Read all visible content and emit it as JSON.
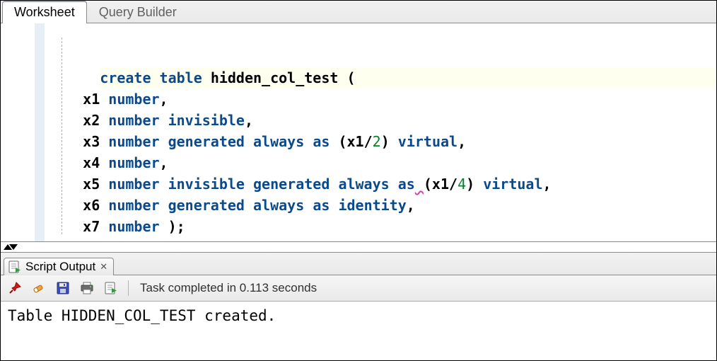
{
  "tabs": {
    "worksheet": "Worksheet",
    "query_builder": "Query Builder"
  },
  "code": {
    "lines": [
      {
        "indent": 0,
        "tokens": [
          {
            "t": "create",
            "c": "kw"
          },
          {
            "t": " ",
            "c": "plain"
          },
          {
            "t": "table",
            "c": "kw"
          },
          {
            "t": " ",
            "c": "plain"
          },
          {
            "t": "hidden_col_test",
            "c": "ident"
          },
          {
            "t": " ",
            "c": "plain"
          },
          {
            "t": "(",
            "c": "paren"
          }
        ],
        "hl": true
      },
      {
        "indent": 1,
        "tokens": [
          {
            "t": "x1 ",
            "c": "plain"
          },
          {
            "t": "number",
            "c": "kw"
          },
          {
            "t": ",",
            "c": "plain"
          }
        ]
      },
      {
        "indent": 1,
        "tokens": [
          {
            "t": "x2 ",
            "c": "plain"
          },
          {
            "t": "number",
            "c": "kw"
          },
          {
            "t": " ",
            "c": "plain"
          },
          {
            "t": "invisible",
            "c": "kw"
          },
          {
            "t": ",",
            "c": "plain"
          }
        ]
      },
      {
        "indent": 1,
        "tokens": [
          {
            "t": "x3 ",
            "c": "plain"
          },
          {
            "t": "number",
            "c": "kw"
          },
          {
            "t": " ",
            "c": "plain"
          },
          {
            "t": "generated",
            "c": "kw"
          },
          {
            "t": " ",
            "c": "plain"
          },
          {
            "t": "always",
            "c": "kw"
          },
          {
            "t": " ",
            "c": "plain"
          },
          {
            "t": "as",
            "c": "kw"
          },
          {
            "t": " ",
            "c": "plain"
          },
          {
            "t": "(",
            "c": "paren"
          },
          {
            "t": "x1",
            "c": "plain"
          },
          {
            "t": "/",
            "c": "plain"
          },
          {
            "t": "2",
            "c": "num"
          },
          {
            "t": ")",
            "c": "paren"
          },
          {
            "t": " ",
            "c": "plain"
          },
          {
            "t": "virtual",
            "c": "kw"
          },
          {
            "t": ",",
            "c": "plain"
          }
        ]
      },
      {
        "indent": 1,
        "tokens": [
          {
            "t": "x4 ",
            "c": "plain"
          },
          {
            "t": "number",
            "c": "kw"
          },
          {
            "t": ",",
            "c": "plain"
          }
        ]
      },
      {
        "indent": 1,
        "tokens": [
          {
            "t": "x5 ",
            "c": "plain"
          },
          {
            "t": "number",
            "c": "kw"
          },
          {
            "t": " ",
            "c": "plain"
          },
          {
            "t": "invisible",
            "c": "kw"
          },
          {
            "t": " ",
            "c": "plain"
          },
          {
            "t": "generated",
            "c": "kw"
          },
          {
            "t": " ",
            "c": "plain"
          },
          {
            "t": "always",
            "c": "kw"
          },
          {
            "t": " ",
            "c": "plain"
          },
          {
            "t": "as",
            "c": "kw"
          },
          {
            "t": " ",
            "c": "plain",
            "sq": true
          },
          {
            "t": "(",
            "c": "paren"
          },
          {
            "t": "x1",
            "c": "plain"
          },
          {
            "t": "/",
            "c": "plain"
          },
          {
            "t": "4",
            "c": "num"
          },
          {
            "t": ")",
            "c": "paren"
          },
          {
            "t": " ",
            "c": "plain"
          },
          {
            "t": "virtual",
            "c": "kw"
          },
          {
            "t": ",",
            "c": "plain"
          }
        ]
      },
      {
        "indent": 1,
        "tokens": [
          {
            "t": "x6 ",
            "c": "plain"
          },
          {
            "t": "number",
            "c": "kw"
          },
          {
            "t": " ",
            "c": "plain"
          },
          {
            "t": "generated",
            "c": "kw"
          },
          {
            "t": " ",
            "c": "plain"
          },
          {
            "t": "always",
            "c": "kw"
          },
          {
            "t": " ",
            "c": "plain"
          },
          {
            "t": "as",
            "c": "kw"
          },
          {
            "t": " ",
            "c": "plain"
          },
          {
            "t": "identity",
            "c": "kw"
          },
          {
            "t": ",",
            "c": "plain"
          }
        ]
      },
      {
        "indent": 1,
        "tokens": [
          {
            "t": "x7 ",
            "c": "plain"
          },
          {
            "t": "number",
            "c": "kw"
          },
          {
            "t": " ",
            "c": "plain"
          },
          {
            "t": ")",
            "c": "paren"
          },
          {
            "t": ";",
            "c": "plain"
          }
        ]
      }
    ]
  },
  "output": {
    "tab_label": "Script Output",
    "status": "Task completed in 0.113 seconds",
    "body": "Table HIDDEN_COL_TEST created."
  },
  "icons": {
    "script_output": "script-output-icon",
    "pin": "pin-icon",
    "erase": "erase-icon",
    "save": "save-icon",
    "print": "print-icon",
    "scroll": "scroll-icon"
  }
}
